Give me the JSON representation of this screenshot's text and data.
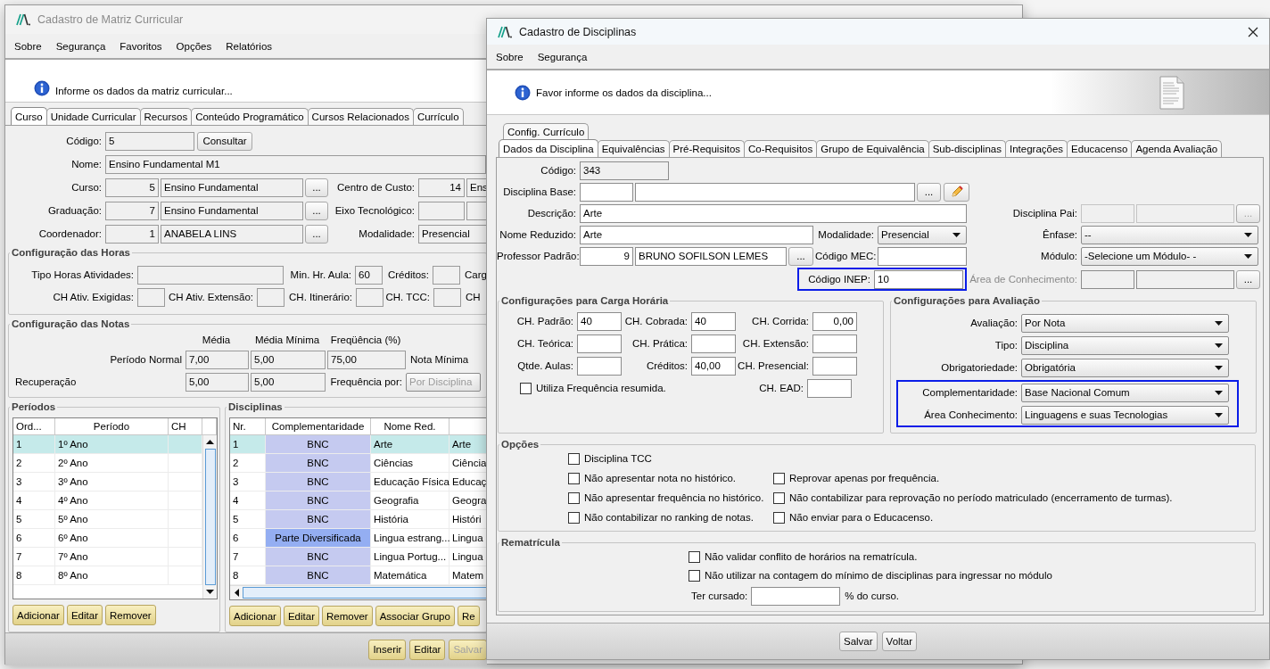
{
  "back_window": {
    "title": "Cadastro de Matriz Curricular",
    "menu": [
      "Sobre",
      "Segurança",
      "Favoritos",
      "Opções",
      "Relatórios"
    ],
    "info": "Informe os dados da matriz curricular...",
    "tabs": [
      {
        "label": "Curso",
        "selected": true
      },
      {
        "label": "Unidade Curricular",
        "selected": false
      },
      {
        "label": "Recursos",
        "selected": false
      },
      {
        "label": "Conteúdo Programático",
        "selected": false
      },
      {
        "label": "Cursos Relacionados",
        "selected": false
      },
      {
        "label": "Currículo",
        "selected": false
      }
    ],
    "codigo": {
      "label": "Código:",
      "value": "5",
      "button": "Consultar"
    },
    "nome": {
      "label": "Nome:",
      "value": "Ensino Fundamental M1"
    },
    "curso": {
      "label": "Curso:",
      "code": "5",
      "name": "Ensino Fundamental",
      "button": "..."
    },
    "centro_de_custo": {
      "label": "Centro de Custo:",
      "code": "14",
      "name": "Ens"
    },
    "graduacao": {
      "label": "Graduação:",
      "code": "7",
      "name": "Ensino Fundamental",
      "button": "..."
    },
    "eixo_tecnologico": {
      "label": "Eixo Tecnológico:"
    },
    "coordenador": {
      "label": "Coordenador:",
      "code": "1",
      "name": "ANABELA LINS",
      "button": "..."
    },
    "modalidade": {
      "label": "Modalidade:",
      "value": "Presencial"
    },
    "horas": {
      "title": "Configuração das Horas",
      "fields": [
        {
          "label": "Tipo Horas Atividades:"
        },
        {
          "label": "Min. Hr. Aula:",
          "value": "60"
        },
        {
          "label": "Créditos:"
        },
        {
          "label": "Carg"
        },
        {
          "label": "CH Ativ. Exigidas:"
        },
        {
          "label": "CH Ativ. Extensão:"
        },
        {
          "label": "CH. Itinerário:"
        },
        {
          "label": "CH. TCC:"
        },
        {
          "label": "CH"
        }
      ]
    },
    "notas": {
      "title": "Configuração das Notas",
      "columns": [
        "Média",
        "Média Mínima",
        "Freqüência (%)"
      ],
      "rows": [
        {
          "label": "Período Normal",
          "values": [
            "7,00",
            "5,00",
            "75,00"
          ]
        },
        {
          "label": "Recuperação",
          "values": [
            "5,00",
            "5,00"
          ]
        }
      ],
      "nota_minima": "Nota Mínima",
      "frequencia_por": {
        "label": "Frequência por:",
        "value": "Por Disciplina",
        "disabled": true
      }
    },
    "periodos": {
      "title": "Períodos",
      "columns": [
        "Ord...",
        "Período",
        "CH"
      ],
      "rows": [
        {
          "ordem": "1",
          "periodo": "1º Ano",
          "selected": true
        },
        {
          "ordem": "2",
          "periodo": "2º Ano",
          "selected": false
        },
        {
          "ordem": "3",
          "periodo": "3º Ano",
          "selected": false
        },
        {
          "ordem": "4",
          "periodo": "4º Ano",
          "selected": false
        },
        {
          "ordem": "5",
          "periodo": "5º Ano",
          "selected": false
        },
        {
          "ordem": "6",
          "periodo": "6º Ano",
          "selected": false
        },
        {
          "ordem": "7",
          "periodo": "7º Ano",
          "selected": false
        },
        {
          "ordem": "8",
          "periodo": "8º Ano",
          "selected": false
        }
      ],
      "buttons": [
        "Adicionar",
        "Editar",
        "Remover"
      ]
    },
    "disciplinas": {
      "title": "Disciplinas",
      "columns": [
        "Nr.",
        "Complementaridade",
        "Nome Red."
      ],
      "rows": [
        {
          "nr": "1",
          "complementaridade": "BNC",
          "nome_red": "Arte",
          "column_4": "Arte",
          "color": "#c5caf0",
          "selected": true
        },
        {
          "nr": "2",
          "complementaridade": "BNC",
          "nome_red": "Ciências",
          "column_4": "Ciência",
          "color": "#c5caf0",
          "selected": false
        },
        {
          "nr": "3",
          "complementaridade": "BNC",
          "nome_red": "Educação Física",
          "column_4": "Educaç",
          "color": "#c5caf0",
          "selected": false
        },
        {
          "nr": "4",
          "complementaridade": "BNC",
          "nome_red": "Geografia",
          "column_4": "Geogra",
          "color": "#c5caf0",
          "selected": false
        },
        {
          "nr": "5",
          "complementaridade": "BNC",
          "nome_red": "História",
          "column_4": "Históri",
          "color": "#c5caf0",
          "selected": false
        },
        {
          "nr": "6",
          "complementaridade": "Parte Diversificada",
          "nome_red": "Lingua estrang...",
          "column_4": "Lingua",
          "color": "#94aef2",
          "selected": false
        },
        {
          "nr": "7",
          "complementaridade": "BNC",
          "nome_red": "Lingua Portug...",
          "column_4": "Lingua",
          "color": "#c5caf0",
          "selected": false
        },
        {
          "nr": "8",
          "complementaridade": "BNC",
          "nome_red": "Matemática",
          "column_4": "Matem",
          "color": "#c5caf0",
          "selected": false
        }
      ],
      "buttons": [
        "Adicionar",
        "Editar",
        "Remover",
        "Associar Grupo",
        "Re"
      ]
    },
    "footer_buttons": [
      {
        "label": "Inserir",
        "disabled": false
      },
      {
        "label": "Editar",
        "disabled": false
      },
      {
        "label": "Salvar",
        "disabled": true
      }
    ]
  },
  "front_window": {
    "title": "Cadastro de Disciplinas",
    "menu": [
      "Sobre",
      "Segurança"
    ],
    "info": "Favor informe os dados da disciplina...",
    "tab_rows": [
      [
        {
          "label": "Config. Currículo",
          "selected": false
        }
      ],
      [
        {
          "label": "Dados da Disciplina",
          "selected": true
        },
        {
          "label": "Equivalências",
          "selected": false
        },
        {
          "label": "Pré-Requisitos",
          "selected": false
        },
        {
          "label": "Co-Requisitos",
          "selected": false
        },
        {
          "label": "Grupo de Equivalência",
          "selected": false
        },
        {
          "label": "Sub-disciplinas",
          "selected": false
        },
        {
          "label": "Integrações",
          "selected": false
        },
        {
          "label": "Educacenso",
          "selected": false
        },
        {
          "label": "Agenda Avaliação",
          "selected": false
        }
      ]
    ],
    "codigo": {
      "label": "Código:",
      "value": "343",
      "readonly": true
    },
    "disciplina_base": {
      "label": "Disciplina Base:",
      "button": "..."
    },
    "descricao": {
      "label": "Descrição:",
      "value": "Arte"
    },
    "disciplina_pai": {
      "label": "Disciplina Pai:",
      "button": "...",
      "disabled": true
    },
    "nome_reduzido": {
      "label": "Nome Reduzido:",
      "value": "Arte"
    },
    "modalidade": {
      "label": "Modalidade:",
      "value": "Presencial"
    },
    "enfase": {
      "label": "Ênfase:",
      "value": "--"
    },
    "professor_padrao": {
      "label": "Professor Padrão:",
      "code": "9",
      "name": "BRUNO SOFILSON LEMES",
      "button": "..."
    },
    "codigo_mec": {
      "label": "Código MEC:"
    },
    "modulo": {
      "label": "Módulo:",
      "value": "-Selecione um Módulo- -"
    },
    "codigo_inep": {
      "label": "Código INEP:",
      "value": "10",
      "highlighted": true
    },
    "area_de_conhecimento": {
      "label": "Área de Conhecimento:",
      "button": "...",
      "disabled": true
    },
    "carga_horaria": {
      "title": "Configurações para Carga Horária",
      "fields": [
        {
          "label": "CH. Padrão:",
          "value": "40"
        },
        {
          "label": "CH. Cobrada:",
          "value": "40"
        },
        {
          "label": "CH. Corrida:",
          "value": "0,00"
        },
        {
          "label": "CH. Teórica:"
        },
        {
          "label": "CH. Prática:"
        },
        {
          "label": "CH. Extensão:"
        },
        {
          "label": "Qtde. Aulas:"
        },
        {
          "label": "Créditos:",
          "value": "40,00"
        },
        {
          "label": "CH. Presencial:"
        },
        {
          "label": "CH. EAD:"
        }
      ],
      "checkbox": {
        "label": "Utiliza Frequência resumida.",
        "checked": false
      }
    },
    "avaliacao": {
      "title": "Configurações para Avaliação",
      "selects": [
        {
          "label": "Avaliação:",
          "value": "Por Nota",
          "highlighted": false
        },
        {
          "label": "Tipo:",
          "value": "Disciplina",
          "highlighted": false
        },
        {
          "label": "Obrigatoriedade:",
          "value": "Obrigatória",
          "highlighted": false
        },
        {
          "label": "Complementaridade:",
          "value": "Base Nacional Comum",
          "highlighted": true
        },
        {
          "label": "Área Conhecimento:",
          "value": "Linguagens e suas Tecnologias",
          "highlighted": true
        }
      ]
    },
    "opcoes": {
      "title": "Opções",
      "checkboxes": [
        {
          "label": "Disciplina TCC",
          "checked": false
        },
        {
          "label": "Não apresentar nota no histórico.",
          "checked": false
        },
        {
          "label": "Reprovar apenas por frequência.",
          "checked": false
        },
        {
          "label": "Não apresentar frequência no histórico.",
          "checked": false
        },
        {
          "label": "Não contabilizar para reprovação no período matriculado (encerramento de turmas).",
          "checked": false
        },
        {
          "label": "Não contabilizar no ranking de notas.",
          "checked": false
        },
        {
          "label": "Não enviar para o Educacenso.",
          "checked": false
        }
      ]
    },
    "rematricula": {
      "title": "Rematrícula",
      "checkboxes": [
        {
          "label": "Não validar conflito de horários na rematrícula.",
          "checked": false
        },
        {
          "label": "Não utilizar na contagem do mínimo de disciplinas para ingressar no módulo",
          "checked": false
        }
      ],
      "ter_cursado": {
        "label": "Ter cursado:",
        "suffix": "% do curso."
      }
    },
    "buttons": [
      "Salvar",
      "Voltar"
    ]
  }
}
